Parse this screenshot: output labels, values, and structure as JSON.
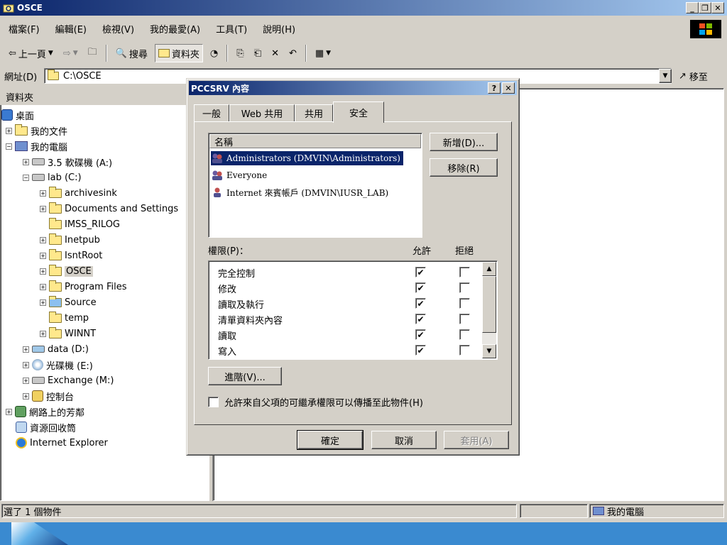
{
  "window": {
    "title": "OSCE",
    "controls": {
      "minimize": "_",
      "maximize": "Б",
      "close": "×"
    }
  },
  "menu": {
    "items": [
      "檔案(F)",
      "編輯(E)",
      "檢視(V)",
      "我的最愛(A)",
      "工具(T)",
      "說明(H)"
    ]
  },
  "toolbar": {
    "back": "上一頁",
    "search": "搜尋",
    "folders": "資料夾"
  },
  "address": {
    "label": "網址(D)",
    "value": "C:\\OSCE",
    "go": "移至"
  },
  "folders_pane": {
    "header": "資料夾",
    "tree": [
      {
        "label": "桌面",
        "icon": "desktop-icon"
      },
      {
        "label": "我的文件",
        "icon": "my-documents-icon"
      },
      {
        "label": "我的電腦",
        "icon": "my-computer-icon"
      },
      {
        "label": "3.5 軟碟機 (A:)",
        "icon": "floppy-icon"
      },
      {
        "label": "lab (C:)",
        "icon": "drive-icon"
      },
      {
        "label": "archivesink",
        "icon": "folder-icon"
      },
      {
        "label": "Documents and Settings",
        "icon": "folder-icon"
      },
      {
        "label": "IMSS_RILOG",
        "icon": "folder-icon"
      },
      {
        "label": "Inetpub",
        "icon": "folder-icon"
      },
      {
        "label": "IsntRoot",
        "icon": "folder-icon"
      },
      {
        "label": "OSCE",
        "icon": "folder-open-icon"
      },
      {
        "label": "Program Files",
        "icon": "folder-icon"
      },
      {
        "label": "Source",
        "icon": "shared-folder-icon"
      },
      {
        "label": "temp",
        "icon": "folder-icon"
      },
      {
        "label": "WINNT",
        "icon": "folder-icon"
      },
      {
        "label": "data (D:)",
        "icon": "drive-icon"
      },
      {
        "label": "光碟機 (E:)",
        "icon": "cdrom-icon"
      },
      {
        "label": "Exchange (M:)",
        "icon": "drive-icon"
      },
      {
        "label": "控制台",
        "icon": "control-panel-icon"
      },
      {
        "label": "網路上的芳鄰",
        "icon": "network-icon"
      },
      {
        "label": "資源回收筒",
        "icon": "recycle-bin-icon"
      },
      {
        "label": "Internet Explorer",
        "icon": "ie-icon"
      }
    ]
  },
  "status": {
    "left": "選了 1 個物件",
    "right": "我的電腦"
  },
  "dialog": {
    "title": "PCCSRV 內容",
    "help": "?",
    "close": "×",
    "tabs": [
      "一般",
      "Web 共用",
      "共用",
      "安全"
    ],
    "active_tab": "安全",
    "names_header": "名稱",
    "names": [
      "Administrators (DMVIN\\Administrators)",
      "Everyone",
      "Internet 來賓帳戶 (DMVIN\\IUSR_LAB)"
    ],
    "add_button": "新增(D)...",
    "remove_button": "移除(R)",
    "permissions_label": "權限(P)：",
    "allow_label": "允許",
    "deny_label": "拒絕",
    "permissions": [
      {
        "name": "完全控制",
        "allow": true,
        "deny": false
      },
      {
        "name": "修改",
        "allow": true,
        "deny": false
      },
      {
        "name": "讀取及執行",
        "allow": true,
        "deny": false
      },
      {
        "name": "清單資料夾內容",
        "allow": true,
        "deny": false
      },
      {
        "name": "讀取",
        "allow": true,
        "deny": false
      },
      {
        "name": "寫入",
        "allow": true,
        "deny": false
      }
    ],
    "advanced_button": "進階(V)...",
    "inherit_label": "允許來自父項的可繼承權限可以傳播至此物件(H)",
    "inherit_checked": false,
    "ok_button": "確定",
    "cancel_button": "取消",
    "apply_button": "套用(A)"
  }
}
